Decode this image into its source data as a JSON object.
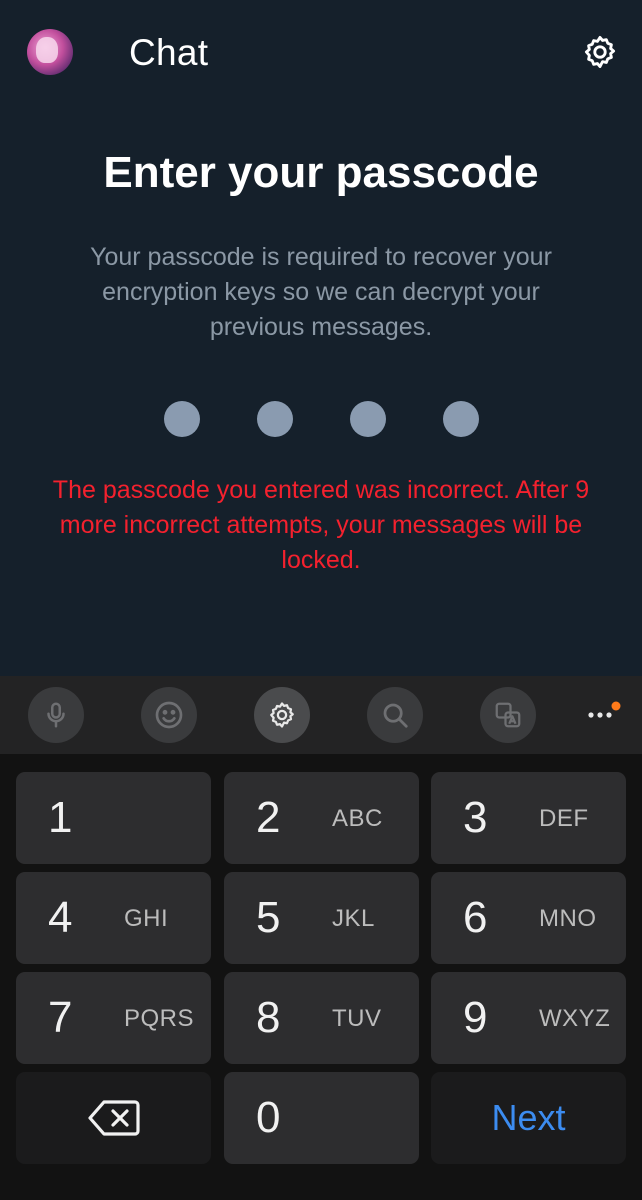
{
  "header": {
    "title": "Chat",
    "avatar_icon": "profile-avatar",
    "settings_icon": "gear-icon"
  },
  "main": {
    "title": "Enter your passcode",
    "description": "Your passcode is required to recover your encryption keys so we can decrypt your previous messages.",
    "passcode_dot_count": 4,
    "passcode_filled": 0,
    "error": "The passcode you entered was incorrect. After 9 more incorrect attempts, your messages will be locked.",
    "colors": {
      "background": "#15202b",
      "error": "#f4212e",
      "muted_text": "#8b98a5"
    }
  },
  "keyboard_toolbar": {
    "icons": [
      "microphone-icon",
      "emoji-icon",
      "gear-icon",
      "search-icon",
      "translate-icon",
      "more-icon"
    ]
  },
  "keypad": {
    "keys": [
      {
        "num": "1",
        "letters": ""
      },
      {
        "num": "2",
        "letters": "ABC"
      },
      {
        "num": "3",
        "letters": "DEF"
      },
      {
        "num": "4",
        "letters": "GHI"
      },
      {
        "num": "5",
        "letters": "JKL"
      },
      {
        "num": "6",
        "letters": "MNO"
      },
      {
        "num": "7",
        "letters": "PQRS"
      },
      {
        "num": "8",
        "letters": "TUV"
      },
      {
        "num": "9",
        "letters": "WXYZ"
      },
      {
        "num": "0",
        "letters": ""
      }
    ],
    "next_label": "Next",
    "accent": "#3c8cf0"
  }
}
